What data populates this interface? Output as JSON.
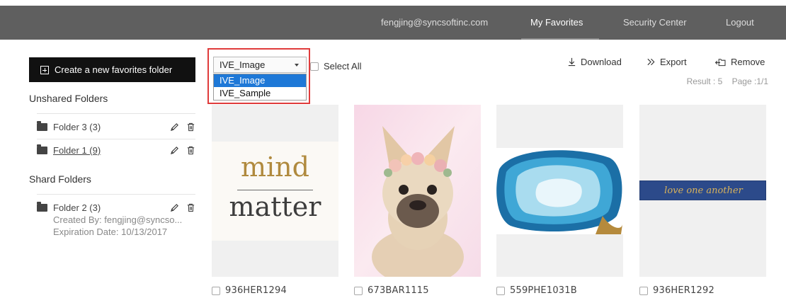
{
  "topbar": {
    "account": "fengjing@syncsoftinc.com",
    "favorites": "My Favorites",
    "security": "Security Center",
    "logout": "Logout"
  },
  "sidebar": {
    "create_button": "Create a new favorites folder",
    "unshared_title": "Unshared Folders",
    "unshared": [
      {
        "label": "Folder 3 (3)"
      },
      {
        "label": "Folder 1 (9)"
      }
    ],
    "shared_title": "Shard Folders",
    "shared": [
      {
        "label": "Folder 2 (3)",
        "created_by": "Created By: fengjing@syncso...",
        "expiration": "Expiration Date: 10/13/2017"
      }
    ]
  },
  "toolbar": {
    "select_value": "IVE_Image",
    "options": [
      "IVE_Image",
      "IVE_Sample"
    ],
    "select_all": "Select All",
    "download": "Download",
    "export": "Export",
    "remove": "Remove",
    "result": "Result : 5",
    "page": "Page :1/1"
  },
  "cards": [
    {
      "id": "936HER1294",
      "thumb_words": [
        "mind",
        "matter"
      ]
    },
    {
      "id": "673BAR1115"
    },
    {
      "id": "559PHE1031B"
    },
    {
      "id": "936HER1292",
      "thumb_words": [
        "love one another"
      ]
    }
  ],
  "colors": {
    "topbar": "#5f5f5f",
    "dropdown_highlight": "#1e78d7",
    "annotation_frame": "#e03c3c",
    "gold_text": "#b08a3e"
  }
}
